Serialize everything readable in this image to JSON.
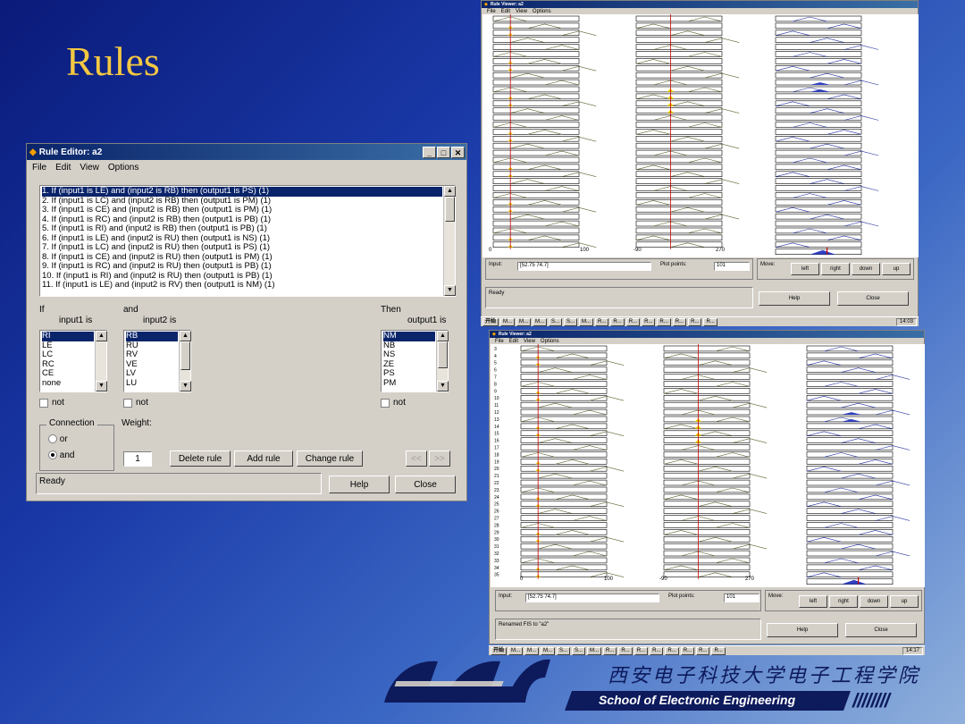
{
  "slide": {
    "title": "Rules",
    "logo_cn": "西安电子科技大学电子工程学院",
    "logo_en": "School of Electronic Engineering",
    "logo_slashes": "////////"
  },
  "rule_editor": {
    "title": "Rule Editor: a2",
    "menu": [
      "File",
      "Edit",
      "View",
      "Options"
    ],
    "rules": [
      "1. If (input1 is LE) and (input2 is RB) then (output1 is PS) (1)",
      "2. If (input1 is LC) and (input2 is RB) then (output1 is PM) (1)",
      "3. If (input1 is CE) and (input2 is RB) then (output1 is PM) (1)",
      "4. If (input1 is RC) and (input2 is RB) then (output1 is PB) (1)",
      "5. If (input1 is RI) and (input2 is RB) then (output1 is PB) (1)",
      "6. If (input1 is LE) and (input2 is RU) then (output1 is NS) (1)",
      "7. If (input1 is LC) and (input2 is RU) then (output1 is PS) (1)",
      "8. If (input1 is CE) and (input2 is RU) then (output1 is PM) (1)",
      "9. If (input1 is RC) and (input2 is RU) then (output1 is PB) (1)",
      "10. If (input1 is RI) and (input2 is RU) then (output1 is PB) (1)",
      "11. If (input1 is LE) and (input2 is RV) then (output1 is NM) (1)"
    ],
    "if_label": "If",
    "and_label": "and",
    "then_label": "Then",
    "input1_label": "input1 is",
    "input2_label": "input2 is",
    "output1_label": "output1 is",
    "input1_options": [
      "RI",
      "LE",
      "LC",
      "RC",
      "CE",
      "none"
    ],
    "input2_options": [
      "RB",
      "RU",
      "RV",
      "VE",
      "LV",
      "LU"
    ],
    "output1_options": [
      "NM",
      "NB",
      "NS",
      "ZE",
      "PS",
      "PM"
    ],
    "not_label": "not",
    "connection_label": "Connection",
    "or_label": "or",
    "and_radio_label": "and",
    "weight_label": "Weight:",
    "weight_value": "1",
    "delete_rule": "Delete rule",
    "add_rule": "Add rule",
    "change_rule": "Change rule",
    "prev": "<<",
    "next": ">>",
    "status": "Ready",
    "help": "Help",
    "close": "Close"
  },
  "viewer_top": {
    "title": "Rule Viewer: a2",
    "menu": [
      "File",
      "Edit",
      "View",
      "Options"
    ],
    "axis_ticks_left": [
      "0",
      "100"
    ],
    "axis_ticks_mid": [
      "-90",
      "270"
    ],
    "input_label": "Input:",
    "input_value": "[52.75 74.7]",
    "plot_points_label": "Plot points:",
    "plot_points_value": "101",
    "move_label": "Move:",
    "left": "left",
    "right": "right",
    "down": "down",
    "up": "up",
    "status": "Ready",
    "help": "Help",
    "close": "Close",
    "clock": "14:03"
  },
  "viewer_bottom": {
    "title": "Rule Viewer: a2",
    "menu": [
      "File",
      "Edit",
      "View",
      "Options"
    ],
    "row_numbers": [
      "3",
      "4",
      "5",
      "6",
      "7",
      "8",
      "9",
      "10",
      "11",
      "12",
      "13",
      "14",
      "15",
      "16",
      "17",
      "18",
      "19",
      "20",
      "21",
      "22",
      "23",
      "24",
      "25",
      "26",
      "27",
      "28",
      "29",
      "30",
      "31",
      "32",
      "33",
      "34",
      "35"
    ],
    "axis_ticks_left": [
      "0",
      "100"
    ],
    "axis_ticks_mid": [
      "-90",
      "270"
    ],
    "input_label": "Input:",
    "input_value": "[52.75 74.7]",
    "plot_points_label": "Plot points:",
    "plot_points_value": "101",
    "move_label": "Move:",
    "left": "left",
    "right": "right",
    "down": "down",
    "up": "up",
    "status": "Renamed FIS to \"a2\"",
    "help": "Help",
    "close": "Close",
    "clock": "14:17"
  },
  "taskbar": {
    "start": "开始",
    "items": [
      "M...",
      "M...",
      "M...",
      "S...",
      "S...",
      "M...",
      "R...",
      "R...",
      "R...",
      "R...",
      "R...",
      "R...",
      "R...",
      "R..."
    ]
  },
  "colors": {
    "title_gold": "#f5c842",
    "titlebar": "#0a246a",
    "window_face": "#d4d0c8",
    "input_line": "#cc0000",
    "mf_fill": "#f0d000",
    "output_fill": "#3040c0"
  }
}
